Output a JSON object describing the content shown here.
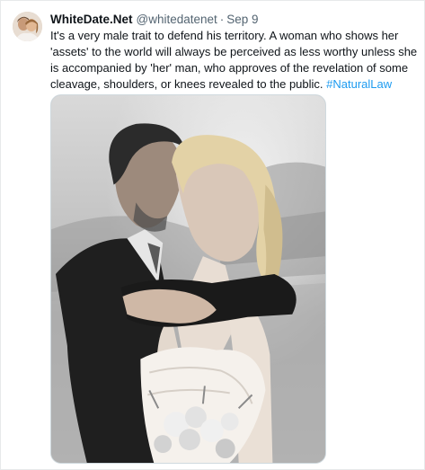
{
  "tweet": {
    "display_name": "WhiteDate.Net",
    "handle": "@whitedatenet",
    "separator": "·",
    "timestamp": "Sep 9",
    "text": "It's a very male trait to defend his territory. A woman who shows her 'assets' to the world will always be perceived as less worthy unless she is accompanied by 'her' man, who approves of the revelation of some cleavage, shoulders, or knees revealed to the public.",
    "hashtag": "#NaturalLaw"
  },
  "colors": {
    "link": "#1d9bf0",
    "secondary_text": "#536471",
    "primary_text": "#0f1419",
    "border": "#cfd9de"
  }
}
